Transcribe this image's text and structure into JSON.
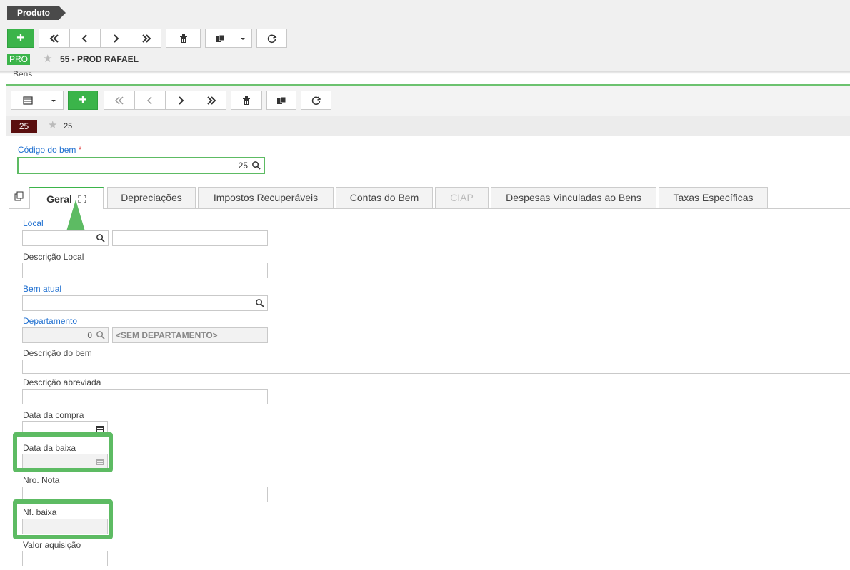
{
  "header": {
    "breadcrumb": "Produto",
    "badge": "PRO",
    "record_title": "55 - PROD RAFAEL"
  },
  "section": {
    "title": "Bens"
  },
  "record": {
    "badge": "25",
    "label": "25"
  },
  "form": {
    "codigo_label": "Código do bem",
    "codigo_required": "*",
    "codigo_value": "25",
    "local_label": "Local",
    "descricao_local_label": "Descrição Local",
    "bem_atual_label": "Bem atual",
    "departamento_label": "Departamento",
    "departamento_value": "0",
    "departamento_desc": "<SEM DEPARTAMENTO>",
    "descricao_bem_label": "Descrição do bem",
    "descricao_abreviada_label": "Descrição abreviada",
    "data_compra_label": "Data da compra",
    "data_baixa_label": "Data da baixa",
    "nro_nota_label": "Nro. Nota",
    "nf_baixa_label": "Nf. baixa",
    "valor_aquisicao_label": "Valor aquisição"
  },
  "tabs": [
    {
      "label": "Geral"
    },
    {
      "label": "Depreciações"
    },
    {
      "label": "Impostos Recuperáveis"
    },
    {
      "label": "Contas do Bem"
    },
    {
      "label": "CIAP"
    },
    {
      "label": "Despesas Vinculadas ao Bens"
    },
    {
      "label": "Taxas Específicas"
    }
  ],
  "colors": {
    "accent_green": "#3bb44a",
    "highlight_green": "#5dbb63",
    "record_badge": "#5a0f0f",
    "label_blue": "#1e6fd0"
  },
  "icons": [
    "plus-icon",
    "first-icon",
    "prev-icon",
    "next-icon",
    "last-icon",
    "trash-icon",
    "copy-icon",
    "caret-down-icon",
    "refresh-icon",
    "grid-icon",
    "star-icon",
    "search-icon",
    "calendar-icon",
    "expand-icon",
    "clone-icon",
    "up-arrow-annotation"
  ]
}
